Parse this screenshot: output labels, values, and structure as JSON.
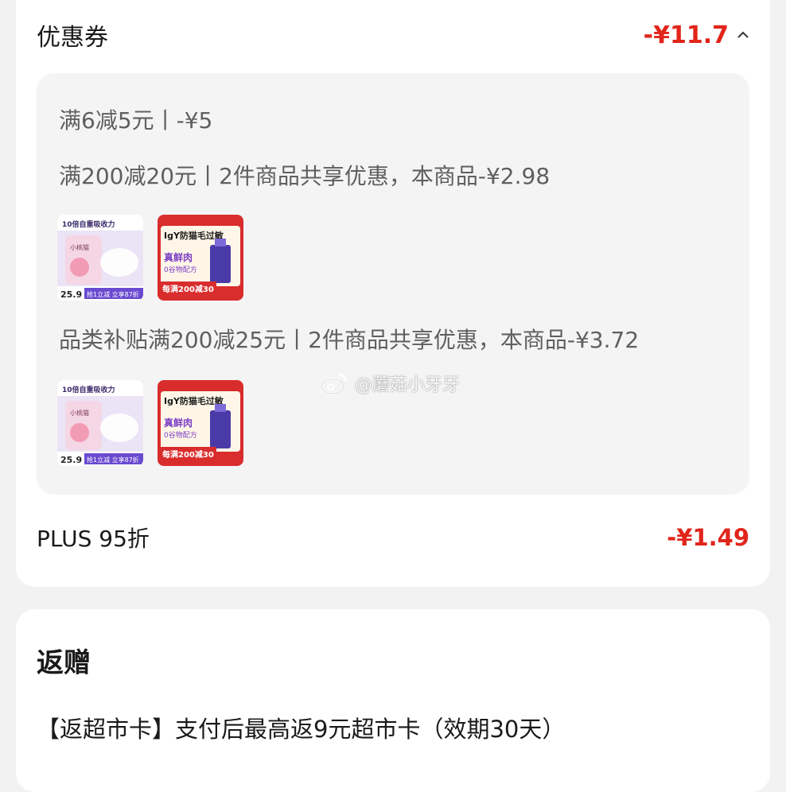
{
  "coupon": {
    "title": "优惠券",
    "total": "-¥11.7",
    "lines": [
      "满6减5元丨-¥5",
      "满200减20元丨2件商品共享优惠，本商品-¥2.98",
      "品类补贴满200减25元丨2件商品共享优惠，本商品-¥3.72"
    ]
  },
  "products": {
    "pad": {
      "headline": "10倍自重吸收力",
      "brand": "小桃猫",
      "price": "25.9",
      "promo": "抢1立减 立享87折"
    },
    "catfood": {
      "headline": "IgY防猫毛过敏",
      "main": "真鲜肉",
      "sub": "0谷物配方",
      "promo": "每满200减30"
    }
  },
  "plus": {
    "label": "PLUS 95折",
    "value": "-¥1.49"
  },
  "gift": {
    "title": "返赠",
    "desc": "【返超市卡】支付后最高返9元超市卡（效期30天）"
  },
  "watermark": {
    "text": "@蘑菇小牙牙"
  },
  "colors": {
    "accent_red": "#e1251b",
    "card_bg": "#ffffff",
    "page_bg": "#f2f2f2"
  }
}
